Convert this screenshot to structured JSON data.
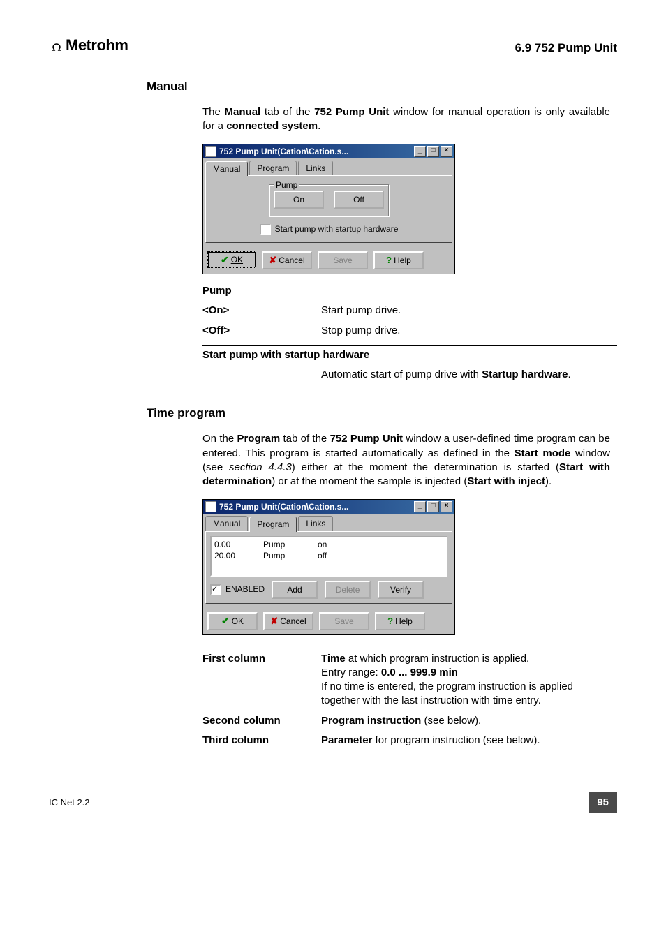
{
  "header": {
    "brand": "Metrohm",
    "right": "6.9  752 Pump Unit"
  },
  "section1": {
    "heading": "Manual",
    "intro_before": "The ",
    "intro_bold1": "Manual",
    "intro_mid1": " tab of the ",
    "intro_bold2": "752 Pump Unit",
    "intro_mid2": " window for manual operation is only available for a ",
    "intro_bold3": "connected system",
    "intro_after": "."
  },
  "win1": {
    "title": "752 Pump Unit(Cation\\Cation.s...",
    "tabs": [
      "Manual",
      "Program",
      "Links"
    ],
    "active_tab": 0,
    "group_label": "Pump",
    "btn_on": "On",
    "btn_off": "Off",
    "checkbox_label": "Start pump with startup hardware",
    "checkbox_checked": false,
    "ok_label": "OK",
    "cancel_label": "Cancel",
    "save_label": "Save",
    "help_label": "Help"
  },
  "defs1_heading": "Pump",
  "defs1": [
    {
      "term": "<On>",
      "desc": "Start pump drive."
    },
    {
      "term": "<Off>",
      "desc": "Stop pump drive."
    }
  ],
  "defs1b_heading": "Start pump with startup hardware",
  "defs1b_desc_before": "Automatic start of pump drive with ",
  "defs1b_desc_bold": "Startup hardware",
  "defs1b_desc_after": ".",
  "section2": {
    "heading": "Time program",
    "p_before": "On the ",
    "p_b1": "Program",
    "p_mid1": " tab of the ",
    "p_b2": "752 Pump Unit",
    "p_mid2": " window a user-defined time program can be entered. This program is started automatically as defined in the ",
    "p_b3": "Start mode",
    "p_mid3": " window (see ",
    "p_i1": "section 4.4.3",
    "p_mid4": ") either at the moment the determination is started (",
    "p_b4": "Start with determination",
    "p_mid5": ") or at the moment the sample is injected (",
    "p_b5": "Start with inject",
    "p_mid6": ")."
  },
  "win2": {
    "title": "752 Pump Unit(Cation\\Cation.s...",
    "tabs": [
      "Manual",
      "Program",
      "Links"
    ],
    "active_tab": 1,
    "rows": [
      {
        "c1": "0.00",
        "c2": "Pump",
        "c3": "on"
      },
      {
        "c1": "20.00",
        "c2": "Pump",
        "c3": "off"
      }
    ],
    "enabled_label": "ENABLED",
    "enabled_checked": true,
    "add_label": "Add",
    "delete_label": "Delete",
    "verify_label": "Verify",
    "ok_label": "OK",
    "cancel_label": "Cancel",
    "save_label": "Save",
    "help_label": "Help"
  },
  "cols": {
    "c1_term": "First column",
    "c1_b": "Time",
    "c1_txt1": " at which program instruction is applied.",
    "c1_txt2a": "Entry range: ",
    "c1_txt2b": "0.0 ... 999.9 min",
    "c1_txt3": "If no time is entered, the program instruction is applied together with the last instruction with time entry.",
    "c2_term": "Second column",
    "c2_b": "Program instruction",
    "c2_txt": " (see below).",
    "c3_term": "Third column",
    "c3_b": "Parameter",
    "c3_txt": " for program instruction (see below)."
  },
  "footer": {
    "left": "IC Net 2.2",
    "page": "95"
  }
}
